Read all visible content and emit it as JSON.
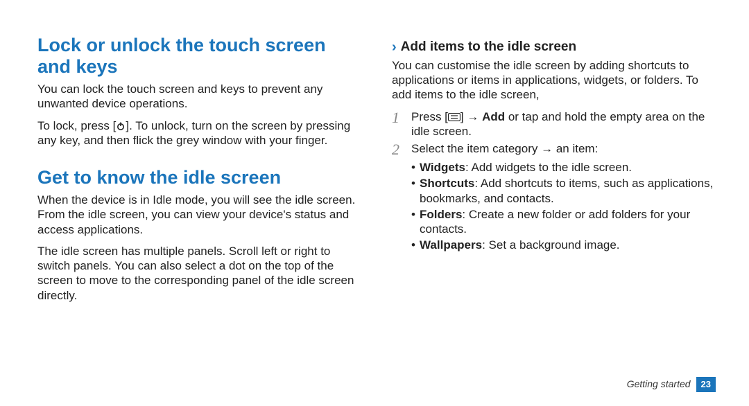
{
  "left": {
    "h1a": "Lock or unlock the touch screen and keys",
    "p1": "You can lock the touch screen and keys to prevent any unwanted device operations.",
    "p2a": "To lock, press [",
    "p2b": "]. To unlock, turn on the screen by pressing any key, and then flick the grey window with your finger.",
    "h1b": "Get to know the idle screen",
    "p3": "When the device is in Idle mode, you will see the idle screen. From the idle screen, you can view your device's status and access applications.",
    "p4": "The idle screen has multiple panels. Scroll left or right to switch panels. You can also select a dot on the top of the screen to move to the corresponding panel of the idle screen directly."
  },
  "right": {
    "sub": "Add items to the idle screen",
    "intro": "You can customise the idle screen by adding shortcuts to applications or items in applications, widgets, or folders. To add items to the idle screen,",
    "step1_a": "Press [",
    "step1_b": "] → ",
    "step1_bold": "Add",
    "step1_c": " or tap and hold the empty area on the idle screen.",
    "step2": "Select the item category → an item:",
    "bullets": [
      {
        "b": "Widgets",
        "t": ": Add widgets to the idle screen."
      },
      {
        "b": "Shortcuts",
        "t": ": Add shortcuts to items, such as applications, bookmarks, and contacts."
      },
      {
        "b": "Folders",
        "t": ": Create a new folder or add folders for your contacts."
      },
      {
        "b": "Wallpapers",
        "t": ": Set a background image."
      }
    ]
  },
  "footer": {
    "section": "Getting started",
    "page": "23"
  }
}
